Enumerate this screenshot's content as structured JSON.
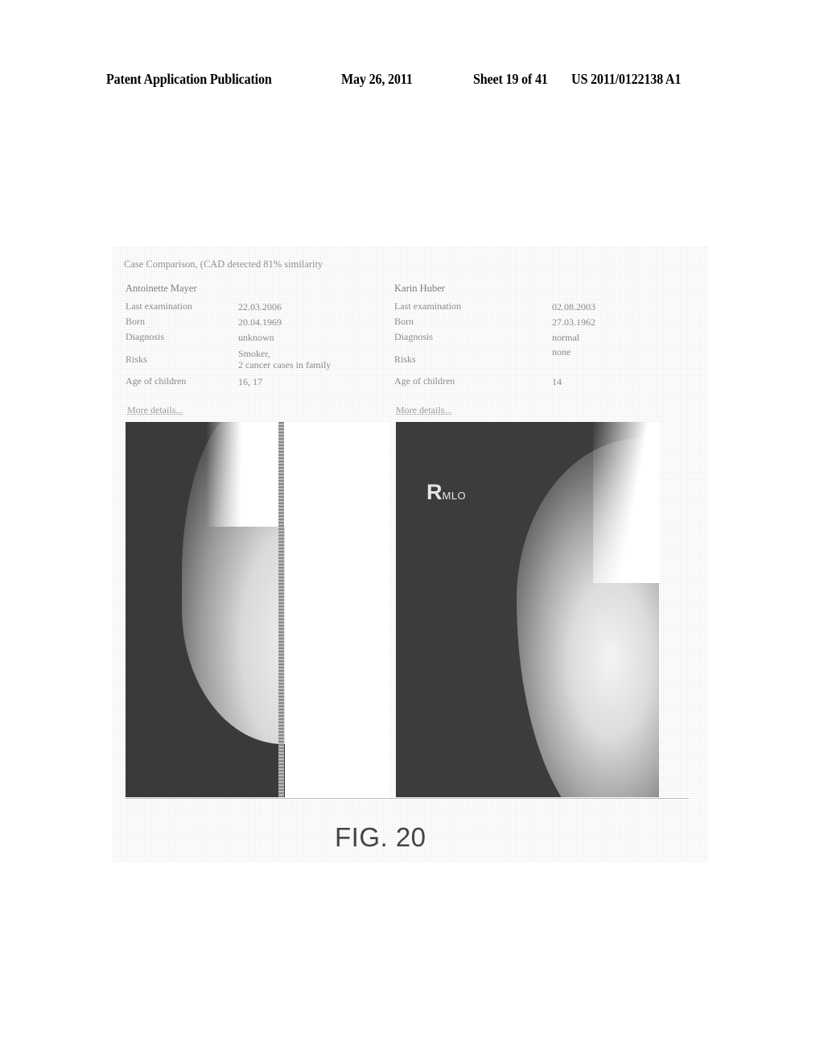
{
  "header": {
    "publication": "Patent Application Publication",
    "date": "May 26, 2011",
    "sheet": "Sheet 19 of 41",
    "number": "US 2011/0122138 A1"
  },
  "figure": {
    "title": "Case Comparison, (CAD detected 81% similarity",
    "caption": "FIG. 20",
    "left_case": {
      "name": "Antoinette Mayer",
      "rows": [
        {
          "label": "Last examination",
          "value": "22.03.2006"
        },
        {
          "label": "Born",
          "value": "20.04.1969"
        },
        {
          "label": "Diagnosis",
          "value": "unknown"
        },
        {
          "label": "Risks",
          "value": "Smoker,",
          "value2": "2 cancer cases in family"
        },
        {
          "label": "Age of children",
          "value": "16, 17"
        }
      ],
      "more_link": "More details..."
    },
    "right_case": {
      "name": "Karin Huber",
      "rows": [
        {
          "label": "Last examination",
          "value": "02.08.2003"
        },
        {
          "label": "Born",
          "value": "27.03.1962"
        },
        {
          "label": "Diagnosis",
          "value": "normal"
        },
        {
          "label": "Risks",
          "value": "none"
        },
        {
          "label": "Age of children",
          "value": "14"
        }
      ],
      "more_link": "More details..."
    },
    "right_image_label": {
      "main": "R",
      "sub": "MLO"
    }
  }
}
